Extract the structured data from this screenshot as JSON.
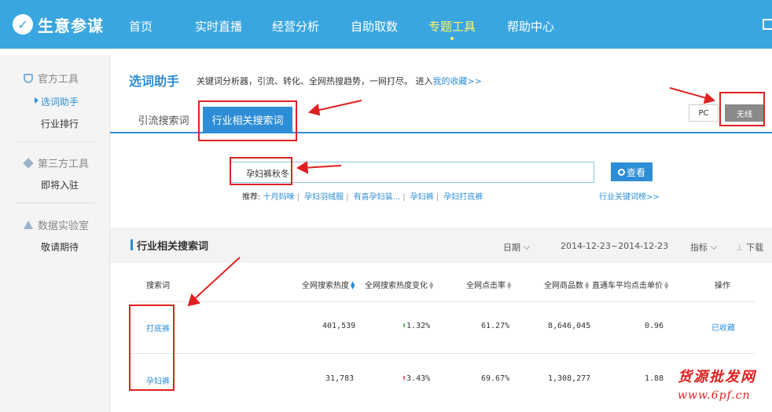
{
  "topbar": {
    "logo_text": "生意参谋",
    "nav": [
      "首页",
      "实时直播",
      "经营分析",
      "自助取数",
      "专题工具",
      "帮助中心"
    ],
    "active_nav": "专题工具",
    "bg_color": "#3aa6e0",
    "active_color": "#fff36b"
  },
  "sidebar": {
    "group1": "官方工具",
    "group1_items": [
      "选词助手",
      "行业排行"
    ],
    "group2": "第三方工具",
    "group2_items": [
      "即将入驻"
    ],
    "group3": "数据实验室",
    "group3_items": [
      "敬请期待"
    ]
  },
  "page": {
    "title": "选词助手",
    "desc_prefix": "关键词分析器，引流、转化、全网热搜趋势，一网打尽。 进入",
    "desc_link": "我的收藏>>",
    "tabs": [
      "引流搜索词",
      "行业相关搜索词"
    ],
    "device_pc": "PC",
    "device_wireless": "无线"
  },
  "search": {
    "value": "孕妇裤秋冬",
    "button": "查看",
    "rec_label": "推荐:",
    "rec_items": [
      "十月妈咪",
      "孕妇羽绒服",
      "有喜孕妇装...",
      "孕妇裤",
      "孕妇打底裤"
    ],
    "industry_link": "行业关键词榜>>"
  },
  "section": {
    "title": "行业相关搜索词",
    "date_label": "日期",
    "date_range": "2014-12-23~2014-12-23",
    "metric_label": "指标",
    "download_label": "下载"
  },
  "table": {
    "headers": [
      "搜索词",
      "全网搜索热度",
      "全网搜索热度变化",
      "全网点击率",
      "全网商品数",
      "直通车平均点击单价",
      "操作"
    ],
    "rows": [
      {
        "keyword": "打底裤",
        "heat": "401,539",
        "change": "1.32%",
        "direction": "down",
        "ctr": "61.27%",
        "goods": "8,646,045",
        "cpc": "0.96",
        "action": "已收藏"
      },
      {
        "keyword": "孕妇裤",
        "heat": "31,783",
        "change": "3.43%",
        "direction": "up",
        "ctr": "69.67%",
        "goods": "1,308,277",
        "cpc": "1.88",
        "action": ""
      }
    ]
  },
  "watermark": {
    "line1": "货源批发网",
    "line2": "www.6pf.cn"
  }
}
